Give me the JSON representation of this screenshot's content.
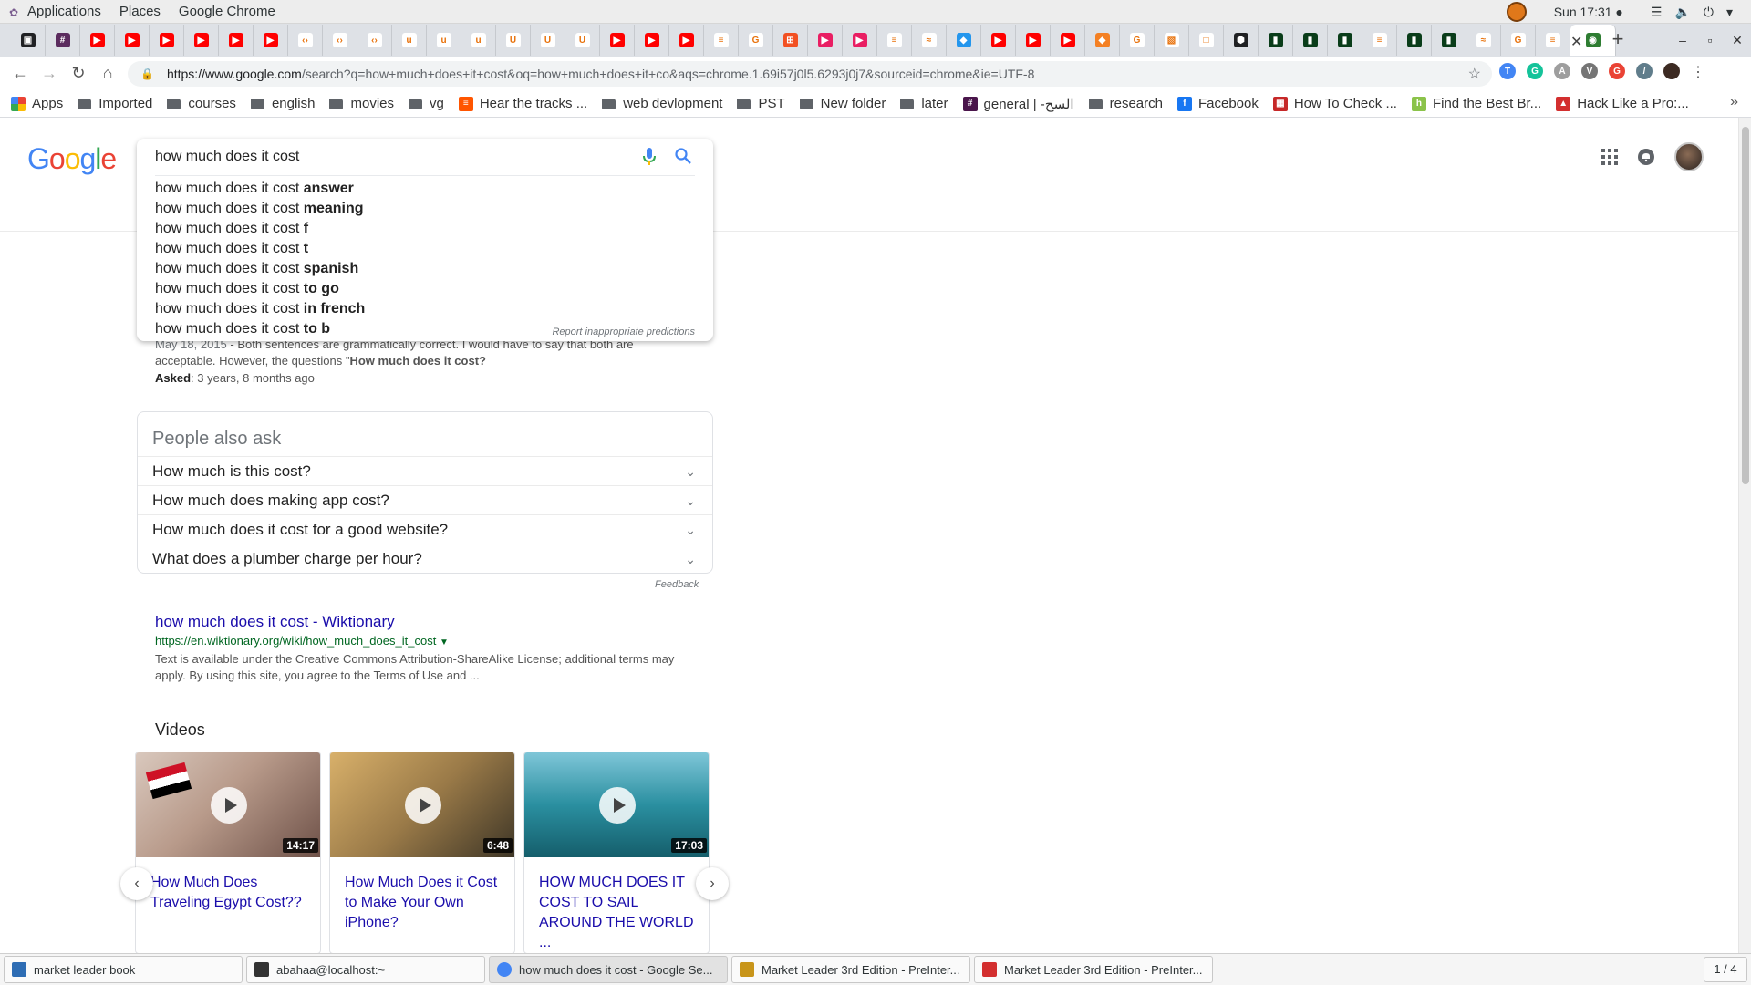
{
  "gnome": {
    "applications": "Applications",
    "places": "Places",
    "app": "Google Chrome",
    "clock": "Sun 17:31 ●"
  },
  "browser": {
    "url_host": "https://www.google.com",
    "url_rest": "/search?q=how+much+does+it+cost&oq=how+much+does+it+co&aqs=chrome.1.69i57j0l5.6293j0j7&sourceid=chrome&ie=UTF-8",
    "pinned_tabs": [
      {
        "color": "#202124",
        "glyph": "▣"
      },
      {
        "color": "#5b2b5e",
        "glyph": "#"
      },
      {
        "color": "#ff0000",
        "glyph": "▶"
      },
      {
        "color": "#ff0000",
        "glyph": "▶"
      },
      {
        "color": "#ff0000",
        "glyph": "▶"
      },
      {
        "color": "#ff0000",
        "glyph": "▶"
      },
      {
        "color": "#ff0000",
        "glyph": "▶"
      },
      {
        "color": "#ff0000",
        "glyph": "▶"
      },
      {
        "color": "#ffffff",
        "glyph": "‹›"
      },
      {
        "color": "#ffffff",
        "glyph": "‹›"
      },
      {
        "color": "#ffffff",
        "glyph": "‹›"
      },
      {
        "color": "#ffffff",
        "glyph": "u"
      },
      {
        "color": "#ffffff",
        "glyph": "u"
      },
      {
        "color": "#ffffff",
        "glyph": "u"
      },
      {
        "color": "#ffffff",
        "glyph": "U"
      },
      {
        "color": "#ffffff",
        "glyph": "U"
      },
      {
        "color": "#ffffff",
        "glyph": "U"
      },
      {
        "color": "#ff0000",
        "glyph": "▶"
      },
      {
        "color": "#ff0000",
        "glyph": "▶"
      },
      {
        "color": "#ff0000",
        "glyph": "▶"
      },
      {
        "color": "#ffffff",
        "glyph": "≡"
      },
      {
        "color": "#ffffff",
        "glyph": "G"
      },
      {
        "color": "#f25022",
        "glyph": "⊞"
      },
      {
        "color": "#e91e63",
        "glyph": "▶"
      },
      {
        "color": "#e91e63",
        "glyph": "▶"
      },
      {
        "color": "#ffffff",
        "glyph": "≡"
      },
      {
        "color": "#ffffff",
        "glyph": "≈"
      },
      {
        "color": "#2496ed",
        "glyph": "◆"
      },
      {
        "color": "#ff0000",
        "glyph": "▶"
      },
      {
        "color": "#ff0000",
        "glyph": "▶"
      },
      {
        "color": "#ff0000",
        "glyph": "▶"
      },
      {
        "color": "#f48024",
        "glyph": "◆"
      },
      {
        "color": "#ffffff",
        "glyph": "G"
      },
      {
        "color": "#ffffff",
        "glyph": "▧"
      },
      {
        "color": "#ffffff",
        "glyph": "□"
      },
      {
        "color": "#202124",
        "glyph": "⬢"
      },
      {
        "color": "#0a3d1a",
        "glyph": "▮"
      },
      {
        "color": "#0a3d1a",
        "glyph": "▮"
      },
      {
        "color": "#0a3d1a",
        "glyph": "▮"
      },
      {
        "color": "#ffffff",
        "glyph": "≡"
      },
      {
        "color": "#0a3d1a",
        "glyph": "▮"
      },
      {
        "color": "#0a3d1a",
        "glyph": "▮"
      },
      {
        "color": "#ffffff",
        "glyph": "≈"
      },
      {
        "color": "#ffffff",
        "glyph": "G"
      },
      {
        "color": "#ffffff",
        "glyph": "≡"
      },
      {
        "color": "#2e7d32",
        "glyph": "◉"
      }
    ],
    "active_tab_close": "✕",
    "new_tab": "+",
    "window_controls": [
      "–",
      "▫",
      "✕"
    ],
    "bookmarks": [
      {
        "label": "Apps",
        "kind": "apps"
      },
      {
        "label": "Imported",
        "kind": "folder"
      },
      {
        "label": "courses",
        "kind": "folder"
      },
      {
        "label": "english",
        "kind": "folder"
      },
      {
        "label": "movies",
        "kind": "folder"
      },
      {
        "label": "vg",
        "kind": "folder"
      },
      {
        "label": "Hear the tracks ...",
        "kind": "site",
        "color": "#ff5500",
        "glyph": "≡"
      },
      {
        "label": "web devlopment",
        "kind": "folder"
      },
      {
        "label": "PST",
        "kind": "folder"
      },
      {
        "label": "New folder",
        "kind": "folder"
      },
      {
        "label": "later",
        "kind": "folder"
      },
      {
        "label": "general | -السح",
        "kind": "site",
        "color": "#4a154b",
        "glyph": "#"
      },
      {
        "label": "research",
        "kind": "folder"
      },
      {
        "label": "Facebook",
        "kind": "site",
        "color": "#1877f2",
        "glyph": "f"
      },
      {
        "label": "How To Check ...",
        "kind": "site",
        "color": "#c62828",
        "glyph": "▦"
      },
      {
        "label": "Find the Best Br...",
        "kind": "site",
        "color": "#8bc34a",
        "glyph": "h"
      },
      {
        "label": "Hack Like a Pro:...",
        "kind": "site",
        "color": "#d32f2f",
        "glyph": "▲"
      }
    ],
    "bookmarks_more": "»"
  },
  "search": {
    "query": "how much does it cost",
    "suggestions": [
      {
        "prefix": "how much does it cost ",
        "bold": "answer"
      },
      {
        "prefix": "how much does it cost ",
        "bold": "meaning"
      },
      {
        "prefix": "how much does it cost ",
        "bold": "f"
      },
      {
        "prefix": "how much does it cost ",
        "bold": "t"
      },
      {
        "prefix": "how much does it cost ",
        "bold": "spanish"
      },
      {
        "prefix": "how much does it cost ",
        "bold": "to go"
      },
      {
        "prefix": "how much does it cost ",
        "bold": "in french"
      },
      {
        "prefix": "how much does it cost ",
        "bold": "to b"
      }
    ],
    "report": "Report inappropriate predictions"
  },
  "snippet": {
    "date": "May 18, 2015",
    "text_part1": " - Both sentences are grammatically correct. I would have to say that both are acceptable. However, the questions \"",
    "text_bold": "How much does it cost?",
    "asked_label": "Asked",
    "asked_value": ": 3 years, 8 months ago"
  },
  "paa": {
    "title": "People also ask",
    "questions": [
      "How much is this cost?",
      "How much does making app cost?",
      "How much does it cost for a good website?",
      "What does a plumber charge per hour?"
    ],
    "feedback": "Feedback"
  },
  "result": {
    "title": "how much does it cost - Wiktionary",
    "url": "https://en.wiktionary.org/wiki/how_much_does_it_cost",
    "desc": "Text is available under the Creative Commons Attribution-ShareAlike License; additional terms may apply. By using this site, you agree to the Terms of Use and ..."
  },
  "videos": {
    "title": "Videos",
    "items": [
      {
        "title": "How Much Does Traveling Egypt Cost??",
        "duration": "14:17"
      },
      {
        "title": "How Much Does it Cost to Make Your Own iPhone?",
        "duration": "6:48"
      },
      {
        "title": "HOW MUCH DOES IT COST TO SAIL AROUND THE WORLD ...",
        "duration": "17:03"
      }
    ]
  },
  "taskbar": {
    "items": [
      {
        "label": "market leader book"
      },
      {
        "label": "abahaa@localhost:~"
      },
      {
        "label": "how much does it cost - Google Se..."
      },
      {
        "label": "Market Leader 3rd Edition - PreInter..."
      },
      {
        "label": "Market Leader 3rd Edition - PreInter..."
      }
    ],
    "workspace": "1 / 4"
  }
}
